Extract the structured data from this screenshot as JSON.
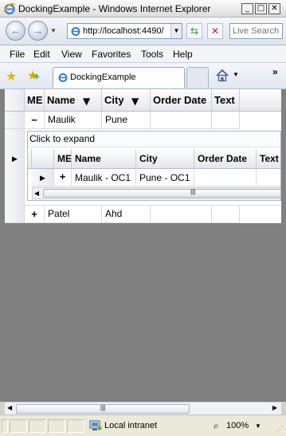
{
  "window": {
    "title": "DockingExample - Windows Internet Explorer",
    "minimize": "_",
    "maximize": "□",
    "close": "✕"
  },
  "address": {
    "back": "←",
    "forward": "→",
    "url": "http://localhost:4490/",
    "refresh": "⇆",
    "stop": "✕",
    "search_placeholder": "Live Search"
  },
  "menu": {
    "items": [
      "File",
      "Edit",
      "View",
      "Favorites",
      "Tools",
      "Help"
    ]
  },
  "favbar": {
    "tab_title": "DockingExample",
    "more": "»"
  },
  "grid": {
    "columns": [
      "ME",
      "Name",
      "City",
      "Order Date",
      "Text"
    ],
    "rows": [
      {
        "expander": "−",
        "name": "Maulik",
        "city": "Pune",
        "order_date": "",
        "text": ""
      },
      {
        "expander": "+",
        "name": "Patel",
        "city": "Ahd",
        "order_date": "",
        "text": ""
      }
    ],
    "detail": {
      "click_to_expand": "Click to expand",
      "columns": [
        "ME",
        "Name",
        "City",
        "Order Date",
        "Text"
      ],
      "rows": [
        {
          "expander": "+",
          "name": "Maulik - OC1",
          "city": "Pune - OC1",
          "order_date": "",
          "text": ""
        }
      ]
    }
  },
  "status": {
    "zone": "Local intranet",
    "zoom": "100%"
  },
  "colors": {
    "content_bg": "#808080",
    "grid_header": "#e4e7eb"
  }
}
